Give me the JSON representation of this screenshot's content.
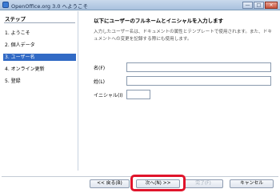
{
  "window": {
    "title": "OpenOffice.org 3.0 へようこそ",
    "minimize_label": "—",
    "maximize_label": "□",
    "close_label": "×"
  },
  "sidebar": {
    "heading": "ステップ",
    "steps": [
      {
        "label": "1. ようこそ"
      },
      {
        "label": "2. 個人データ"
      },
      {
        "label": "3. ユーザー名"
      },
      {
        "label": "4. オンライン更新"
      },
      {
        "label": "5. 登録"
      }
    ]
  },
  "main": {
    "heading": "以下にユーザーのフルネームとイニシャルを入力します",
    "description": "入力したユーザー名は、ドキュメントの属性とテンプレートで使用されます。また、ドキュメントへの変更を記録する際にも使用します。",
    "fields": {
      "surname": {
        "label": "名(F)",
        "value": ""
      },
      "given_name": {
        "label": "姓(L)",
        "value": ""
      },
      "initials": {
        "label": "イニシャル(I)",
        "value": ""
      }
    }
  },
  "footer": {
    "back_label": "<< 戻る(B)",
    "next_label": "次へ(N) >>",
    "finish_label": "完了(F)",
    "cancel_label": "キャンセル"
  },
  "colors": {
    "active_step": "#316ac5",
    "highlight": "#e0142b"
  }
}
